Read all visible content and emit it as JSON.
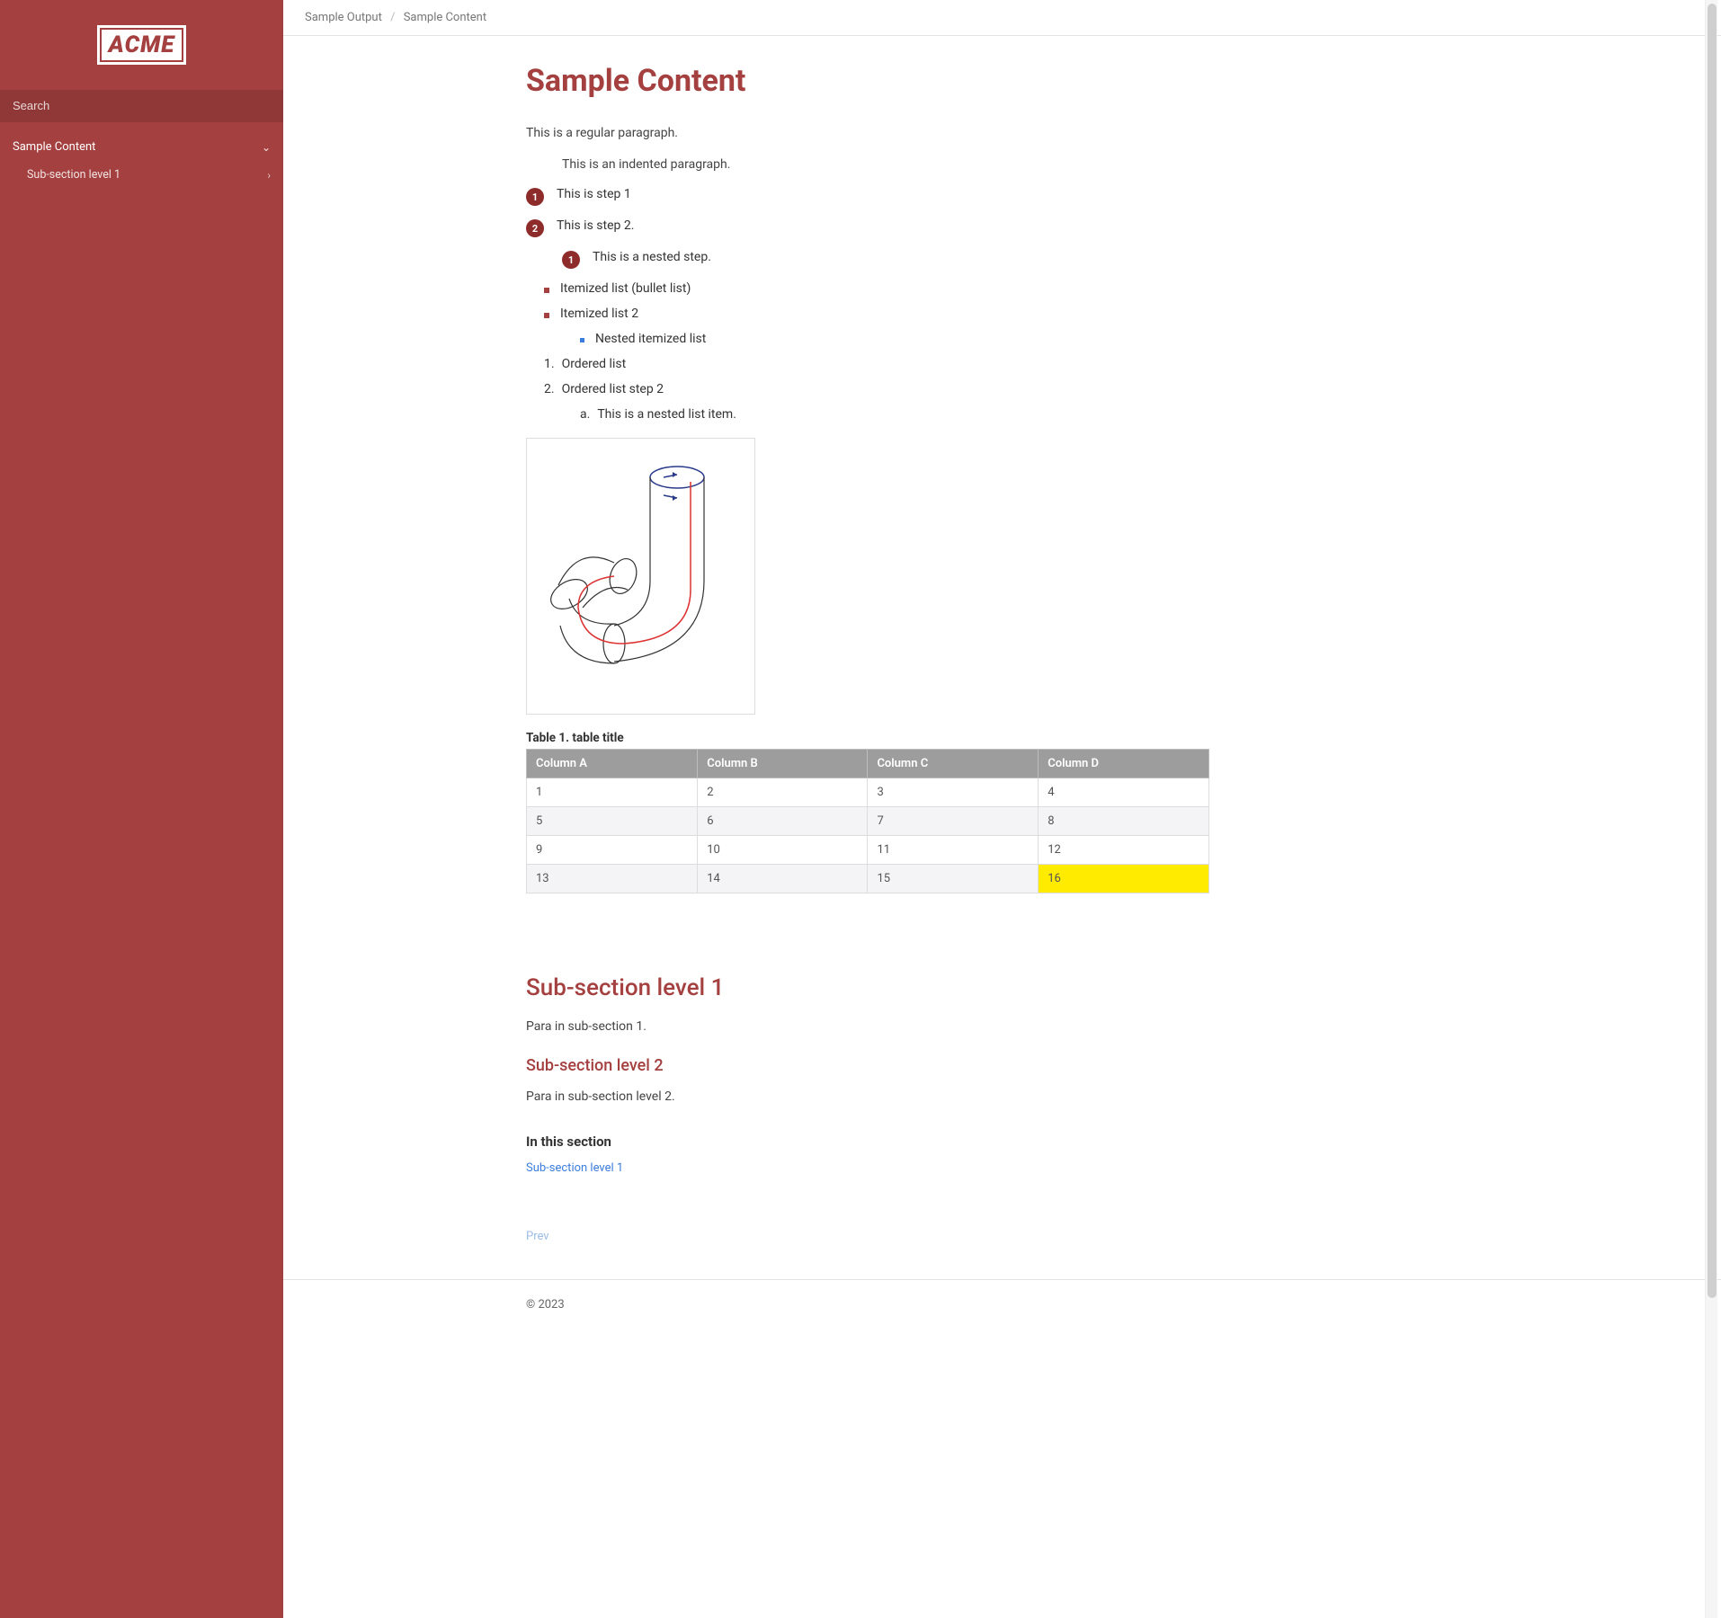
{
  "logo": "ACME",
  "search": {
    "placeholder": "Search"
  },
  "nav": {
    "item1": "Sample Content",
    "item1_child": "Sub-section level 1"
  },
  "breadcrumb": {
    "root": "Sample Output",
    "current": "Sample Content"
  },
  "title": "Sample Content",
  "p_regular": "This is a regular paragraph.",
  "p_indented": "This is an indented paragraph.",
  "step1": "This is step 1",
  "step2": "This is step 2.",
  "step2_nested": "This is a nested step.",
  "item_a": "Itemized list (bullet list)",
  "item_b": "Itemized list 2",
  "item_b_nested": "Nested itemized list",
  "ol1": "Ordered list",
  "ol2": "Ordered list step 2",
  "ol2_nested": "This is a nested list item.",
  "table": {
    "caption": "Table 1. table title",
    "headers": {
      "a": "Column A",
      "b": "Column B",
      "c": "Column C",
      "d": "Column D"
    },
    "rows": [
      {
        "a": "1",
        "b": "2",
        "c": "3",
        "d": "4"
      },
      {
        "a": "5",
        "b": "6",
        "c": "7",
        "d": "8"
      },
      {
        "a": "9",
        "b": "10",
        "c": "11",
        "d": "12"
      },
      {
        "a": "13",
        "b": "14",
        "c": "15",
        "d": "16"
      }
    ]
  },
  "sub1_title": "Sub-section level 1",
  "sub1_para": "Para in sub-section 1.",
  "sub2_title": "Sub-section level 2",
  "sub2_para": "Para in sub-section level 2.",
  "inthis_title": "In this section",
  "inthis_link": "Sub-section level 1",
  "pager_prev": "Prev",
  "footer": "© 2023"
}
